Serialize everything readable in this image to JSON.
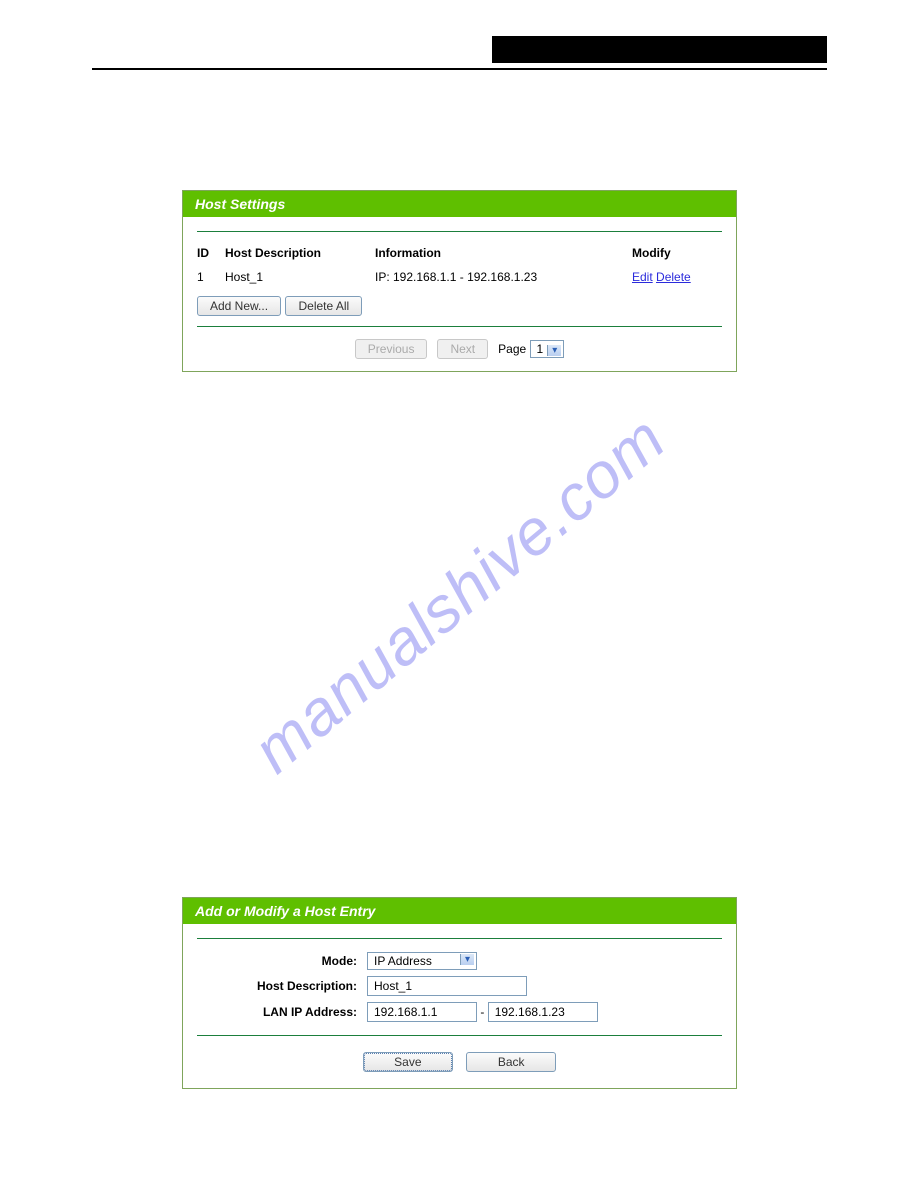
{
  "watermark": "manualshive.com",
  "host_panel": {
    "title": "Host Settings",
    "columns": {
      "id": "ID",
      "desc": "Host Description",
      "info": "Information",
      "modify": "Modify"
    },
    "rows": [
      {
        "id": "1",
        "desc": "Host_1",
        "info": "IP: 192.168.1.1 - 192.168.1.23",
        "edit": "Edit",
        "delete": "Delete"
      }
    ],
    "buttons": {
      "add": "Add New...",
      "delete_all": "Delete All",
      "prev": "Previous",
      "next": "Next"
    },
    "page_label": "Page",
    "page_value": "1"
  },
  "modify_panel": {
    "title": "Add or Modify a Host Entry",
    "labels": {
      "mode": "Mode:",
      "desc": "Host Description:",
      "lan": "LAN IP Address:"
    },
    "mode_value": "IP Address",
    "desc_value": "Host_1",
    "ip_from": "192.168.1.1",
    "ip_to": "192.168.1.23",
    "ip_sep": "-",
    "buttons": {
      "save": "Save",
      "back": "Back"
    }
  }
}
